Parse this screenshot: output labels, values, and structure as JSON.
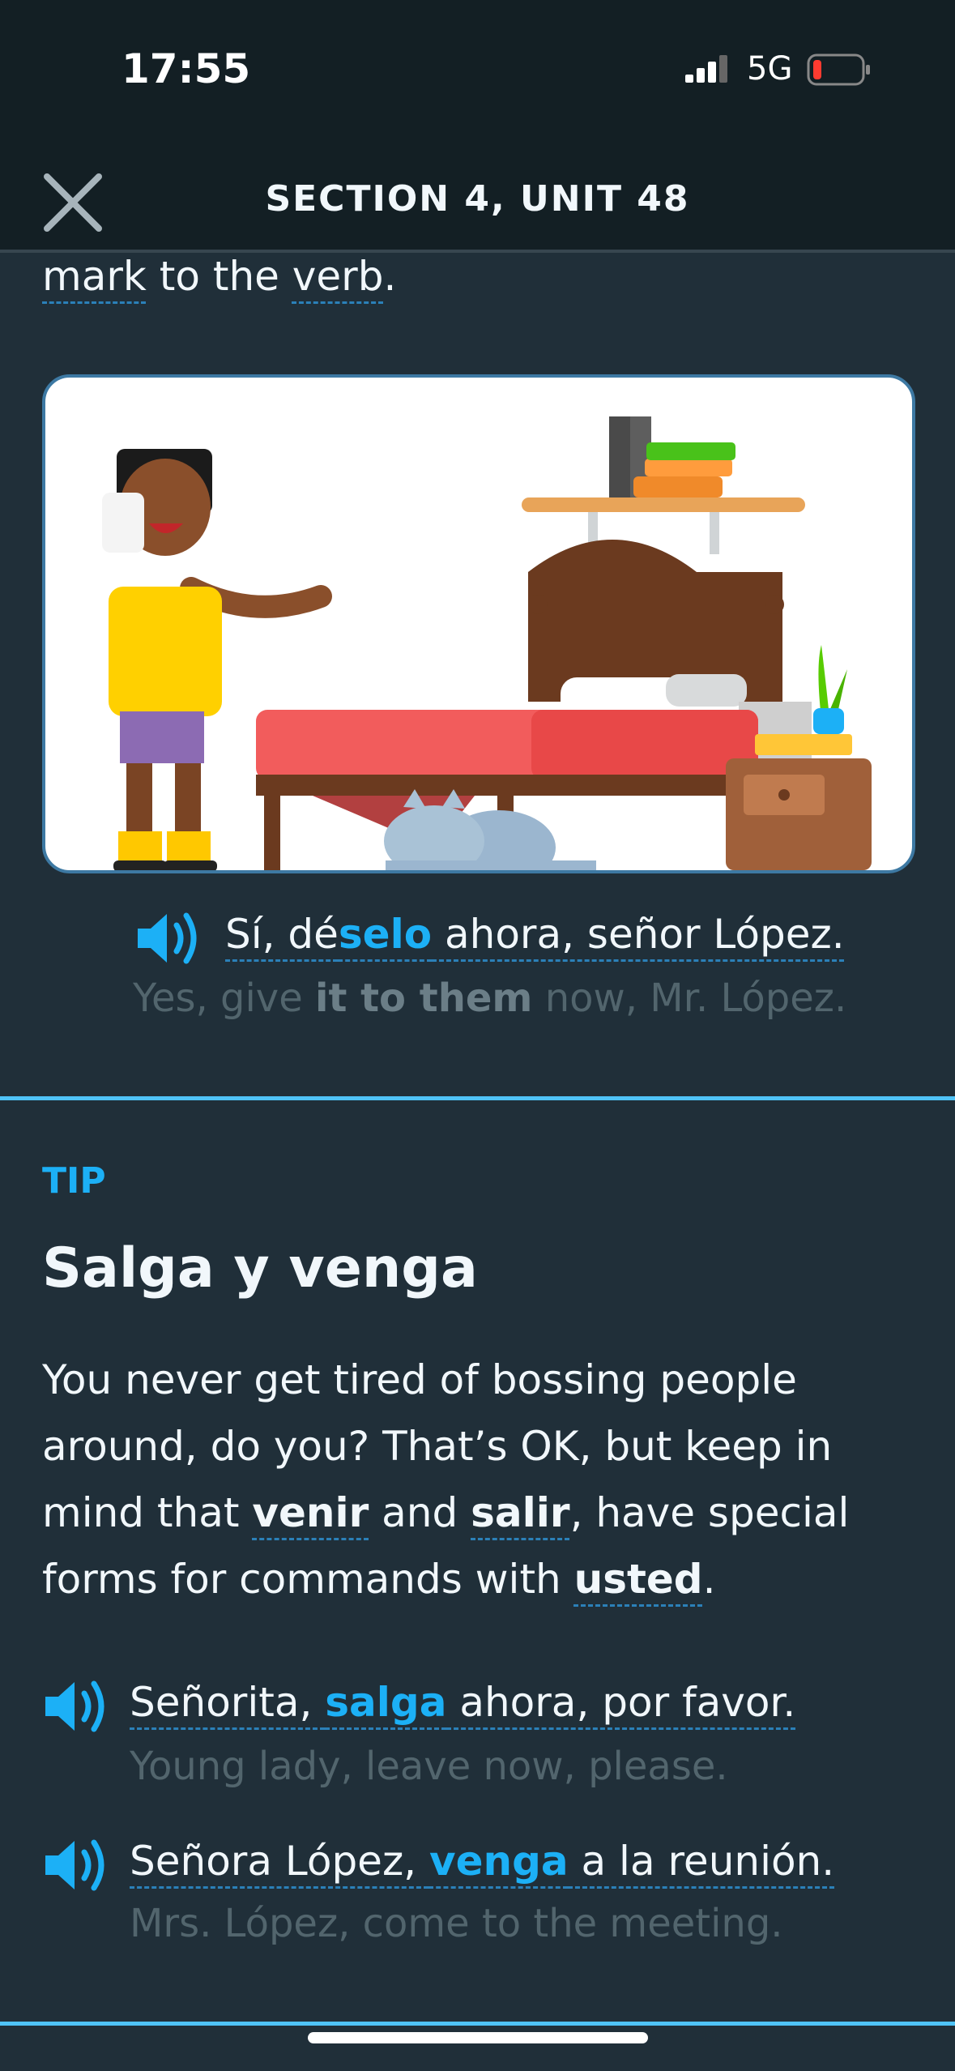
{
  "status_bar": {
    "time": "17:55",
    "network": "5G"
  },
  "header": {
    "title": "SECTION 4, UNIT 48"
  },
  "intro": {
    "word_mark": "mark",
    "word_to_the": " to the ",
    "word_verb": "verb",
    "period": "."
  },
  "example_top": {
    "es_pre": "Sí, dé",
    "es_hl": "selo",
    "es_post": " ahora, señor López.",
    "en_pre": "Yes, give ",
    "en_bold": "it to them",
    "en_post": " now, Mr. López."
  },
  "tip": {
    "label": "TIP",
    "title": "Salga y venga",
    "p1": "You never get tired of bossing people around, do you? That’s OK, but keep in mind that ",
    "venir": "venir",
    "and": " and ",
    "salir": "salir",
    "p2": ", have special forms for commands with ",
    "usted": "usted",
    "end": "."
  },
  "examples": [
    {
      "es_pre": "Señorita, ",
      "es_hl": "salga",
      "es_post": " ahora, por favor.",
      "en": "Young lady, leave now, please."
    },
    {
      "es_pre": "Señora López, ",
      "es_hl": "venga",
      "es_post": " a la reunión.",
      "en": "Mrs. López, come to the meeting."
    }
  ],
  "colors": {
    "background": "#202f39",
    "header": "#131f24",
    "accent": "#1cb0f6",
    "muted": "#52656d"
  },
  "icons": [
    "signal-icon",
    "battery-icon",
    "close-icon",
    "speaker-icon"
  ]
}
